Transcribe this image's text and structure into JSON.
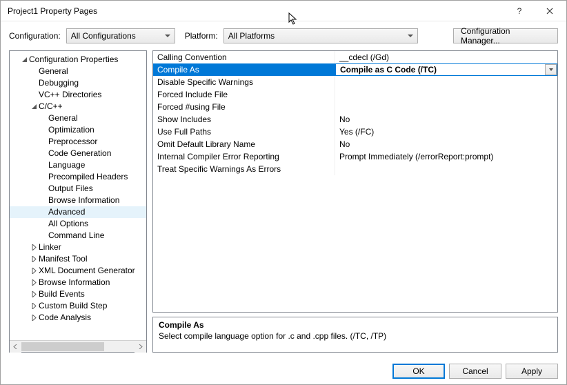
{
  "window": {
    "title": "Project1 Property Pages"
  },
  "toolbar": {
    "configuration_label": "Configuration:",
    "configuration_value": "All Configurations",
    "platform_label": "Platform:",
    "platform_value": "All Platforms",
    "config_manager_label": "Configuration Manager..."
  },
  "tree": {
    "root": "Configuration Properties",
    "items": [
      "General",
      "Debugging",
      "VC++ Directories"
    ],
    "cpp": {
      "label": "C/C++",
      "children": [
        "General",
        "Optimization",
        "Preprocessor",
        "Code Generation",
        "Language",
        "Precompiled Headers",
        "Output Files",
        "Browse Information",
        "Advanced",
        "All Options",
        "Command Line"
      ],
      "selected_index": 8
    },
    "rest": [
      "Linker",
      "Manifest Tool",
      "XML Document Generator",
      "Browse Information",
      "Build Events",
      "Custom Build Step",
      "Code Analysis"
    ]
  },
  "grid": {
    "rows": [
      {
        "name": "Calling Convention",
        "value": "__cdecl (/Gd)"
      },
      {
        "name": "Compile As",
        "value": "Compile as C Code (/TC)",
        "selected": true
      },
      {
        "name": "Disable Specific Warnings",
        "value": ""
      },
      {
        "name": "Forced Include File",
        "value": ""
      },
      {
        "name": "Forced #using File",
        "value": ""
      },
      {
        "name": "Show Includes",
        "value": "No"
      },
      {
        "name": "Use Full Paths",
        "value": "Yes (/FC)"
      },
      {
        "name": "Omit Default Library Name",
        "value": "No"
      },
      {
        "name": "Internal Compiler Error Reporting",
        "value": "Prompt Immediately (/errorReport:prompt)"
      },
      {
        "name": "Treat Specific Warnings As Errors",
        "value": ""
      }
    ]
  },
  "description": {
    "title": "Compile As",
    "text": "Select compile language option for .c and .cpp files.     (/TC, /TP)"
  },
  "footer": {
    "ok": "OK",
    "cancel": "Cancel",
    "apply": "Apply"
  }
}
